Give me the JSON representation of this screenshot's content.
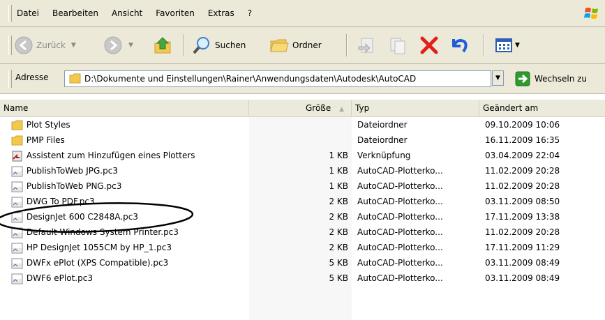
{
  "menu": {
    "items": [
      "Datei",
      "Bearbeiten",
      "Ansicht",
      "Favoriten",
      "Extras",
      "?"
    ]
  },
  "toolbar": {
    "back_label": "Zurück",
    "search_label": "Suchen",
    "folders_label": "Ordner"
  },
  "address": {
    "label": "Adresse",
    "path": "D:\\Dokumente und Einstellungen\\Rainer\\Anwendungsdaten\\Autodesk\\AutoCAD",
    "go_label": "Wechseln zu"
  },
  "columns": {
    "name": "Name",
    "size": "Größe",
    "type": "Typ",
    "modified": "Geändert am"
  },
  "files": [
    {
      "name": "Plot Styles",
      "size": "",
      "type": "Dateiordner",
      "modified": "09.10.2009 10:06",
      "icon": "folder-icon"
    },
    {
      "name": "PMP Files",
      "size": "",
      "type": "Dateiordner",
      "modified": "16.11.2009 16:35",
      "icon": "folder-icon"
    },
    {
      "name": "Assistent zum Hinzufügen eines Plotters",
      "size": "1 KB",
      "type": "Verknüpfung",
      "modified": "03.04.2009 22:04",
      "icon": "shortcut-icon"
    },
    {
      "name": "PublishToWeb JPG.pc3",
      "size": "1 KB",
      "type": "AutoCAD-Plotterko...",
      "modified": "11.02.2009 20:28",
      "icon": "pc3-file-icon"
    },
    {
      "name": "PublishToWeb PNG.pc3",
      "size": "1 KB",
      "type": "AutoCAD-Plotterko...",
      "modified": "11.02.2009 20:28",
      "icon": "pc3-file-icon"
    },
    {
      "name": "DWG To PDF.pc3",
      "size": "2 KB",
      "type": "AutoCAD-Plotterko...",
      "modified": "03.11.2009 08:50",
      "icon": "pc3-file-icon"
    },
    {
      "name": "DesignJet 600 C2848A.pc3",
      "size": "2 KB",
      "type": "AutoCAD-Plotterko...",
      "modified": "17.11.2009 13:38",
      "icon": "pc3-file-icon"
    },
    {
      "name": "Default Windows System Printer.pc3",
      "size": "2 KB",
      "type": "AutoCAD-Plotterko...",
      "modified": "11.02.2009 20:28",
      "icon": "pc3-file-icon"
    },
    {
      "name": "HP DesignJet 1055CM by HP_1.pc3",
      "size": "2 KB",
      "type": "AutoCAD-Plotterko...",
      "modified": "17.11.2009 11:29",
      "icon": "pc3-file-icon"
    },
    {
      "name": "DWFx ePlot (XPS Compatible).pc3",
      "size": "5 KB",
      "type": "AutoCAD-Plotterko...",
      "modified": "03.11.2009 08:49",
      "icon": "pc3-file-icon"
    },
    {
      "name": "DWF6 ePlot.pc3",
      "size": "5 KB",
      "type": "AutoCAD-Plotterko...",
      "modified": "03.11.2009 08:49",
      "icon": "pc3-file-icon"
    }
  ],
  "colors": {
    "toolbar_bg": "#ece9d8",
    "header_bg": "#ebeadb",
    "annotation": "#000000",
    "delete_red": "#e0201a",
    "go_green": "#2f9a2f"
  }
}
